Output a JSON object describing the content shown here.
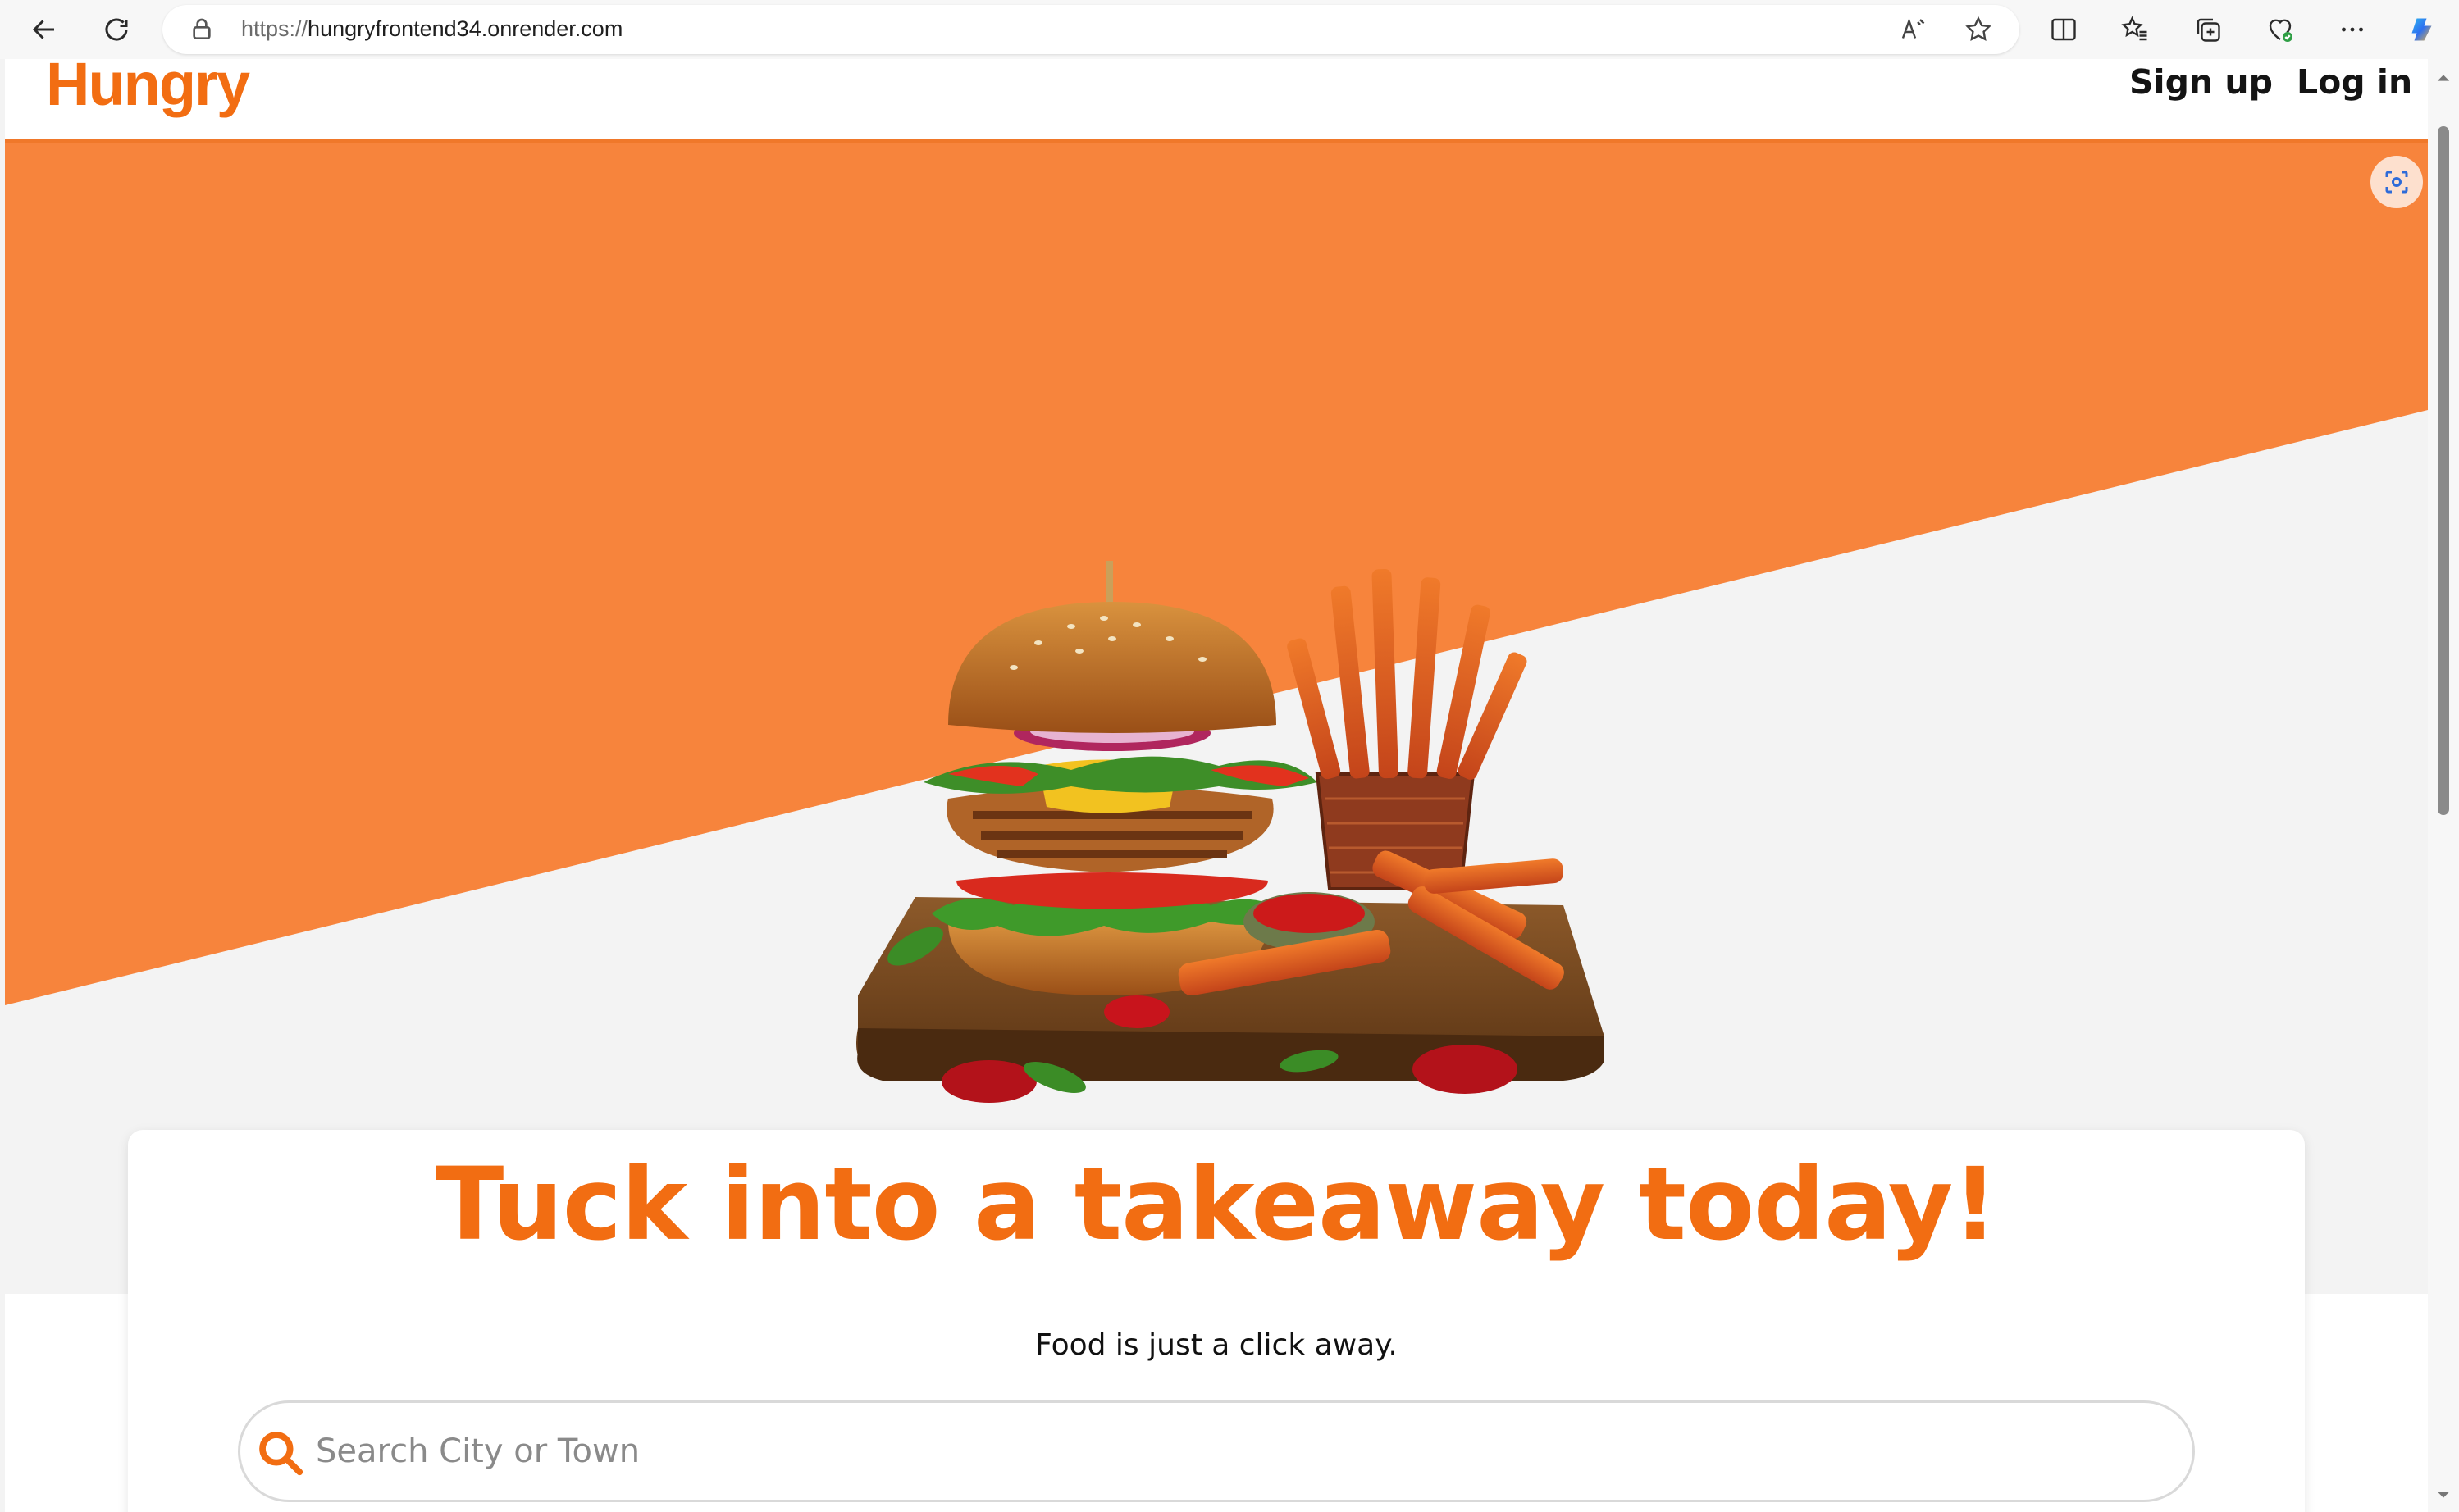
{
  "browser": {
    "url_scheme": "https://",
    "url_host": "hungryfrontend34.onrender.com"
  },
  "nav": {
    "logo": "Hungry",
    "signup": "Sign up",
    "login": "Log in"
  },
  "hero": {
    "headline": "Tuck into a takeaway today!",
    "subline": "Food is just a click away."
  },
  "search": {
    "placeholder": "Search City or Town"
  },
  "colors": {
    "brand": "#f26d12",
    "hero_orange": "#f7843c",
    "hero_light": "#f3f3f3"
  }
}
